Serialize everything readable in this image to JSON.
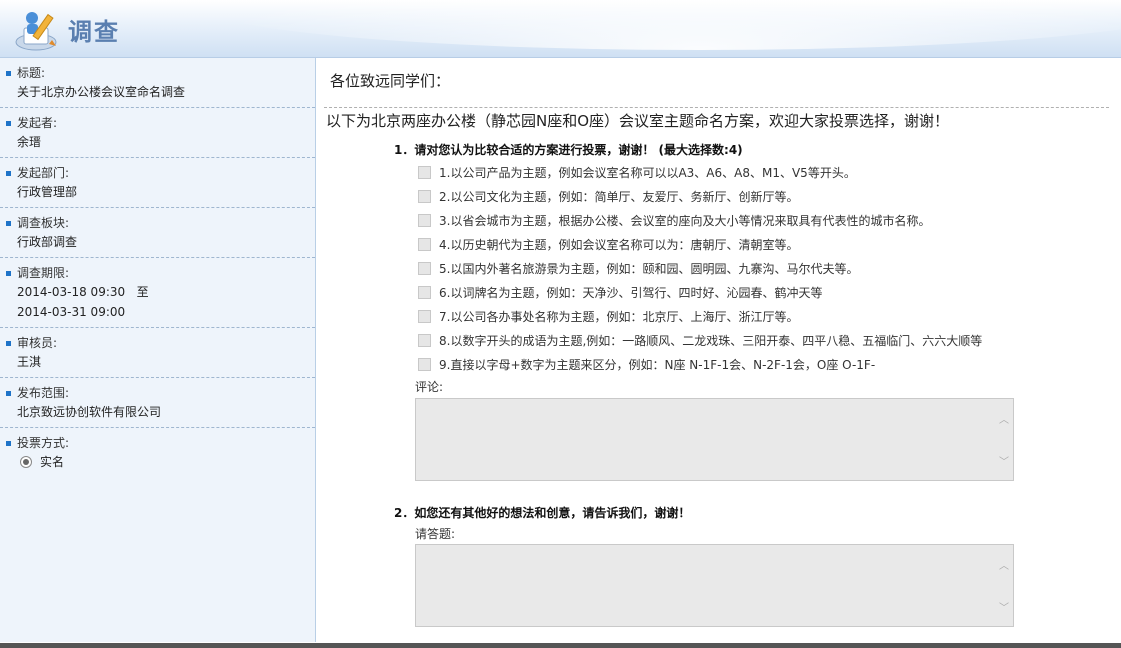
{
  "header": {
    "title": "调查",
    "icon": "survey-pencil-icon"
  },
  "sidebar": {
    "items": [
      {
        "label": "标题:",
        "value": "关于北京办公楼会议室命名调查"
      },
      {
        "label": "发起者:",
        "value": "余瑨"
      },
      {
        "label": "发起部门:",
        "value": "行政管理部"
      },
      {
        "label": "调查板块:",
        "value": "行政部调查"
      },
      {
        "label": "调查期限:",
        "value": "2014-03-18 09:30   至",
        "value2": "2014-03-31 09:00"
      },
      {
        "label": "审核员:",
        "value": "王淇"
      },
      {
        "label": "发布范围:",
        "value": "北京致远协创软件有限公司"
      },
      {
        "label": "投票方式:",
        "radio": "实名"
      }
    ]
  },
  "main": {
    "greeting": "各位致远同学们：",
    "intro": "以下为北京两座办公楼（静芯园N座和O座）会议室主题命名方案，欢迎大家投票选择，谢谢！",
    "q1": {
      "title": "1．请对您认为比较合适的方案进行投票，谢谢！   (最大选择数:4)",
      "options": [
        "1.以公司产品为主题，例如会议室名称可以以A3、A6、A8、M1、V5等开头。",
        "2.以公司文化为主题，例如：简单厅、友爱厅、务新厅、创新厅等。",
        "3.以省会城市为主题，根据办公楼、会议室的座向及大小等情况来取具有代表性的城市名称。",
        "4.以历史朝代为主题，例如会议室名称可以为：唐朝厅、清朝室等。",
        "5.以国内外著名旅游景为主题，例如：颐和园、圆明园、九寨沟、马尔代夫等。",
        "6.以词牌名为主题，例如：天净沙、引驾行、四时好、沁园春、鹤冲天等",
        "7.以公司各办事处名称为主题，例如：北京厅、上海厅、浙江厅等。",
        "8.以数字开头的成语为主题,例如：一路顺风、二龙戏珠、三阳开泰、四平八稳、五福临门、六六大顺等",
        "9.直接以字母+数字为主题来区分，例如：N座 N-1F-1会、N-2F-1会，O座 O-1F-"
      ],
      "comment_label": "评论:"
    },
    "q2": {
      "title": "2．如您还有其他好的想法和创意，请告诉我们，谢谢！",
      "answer_label": "请答题:"
    }
  }
}
